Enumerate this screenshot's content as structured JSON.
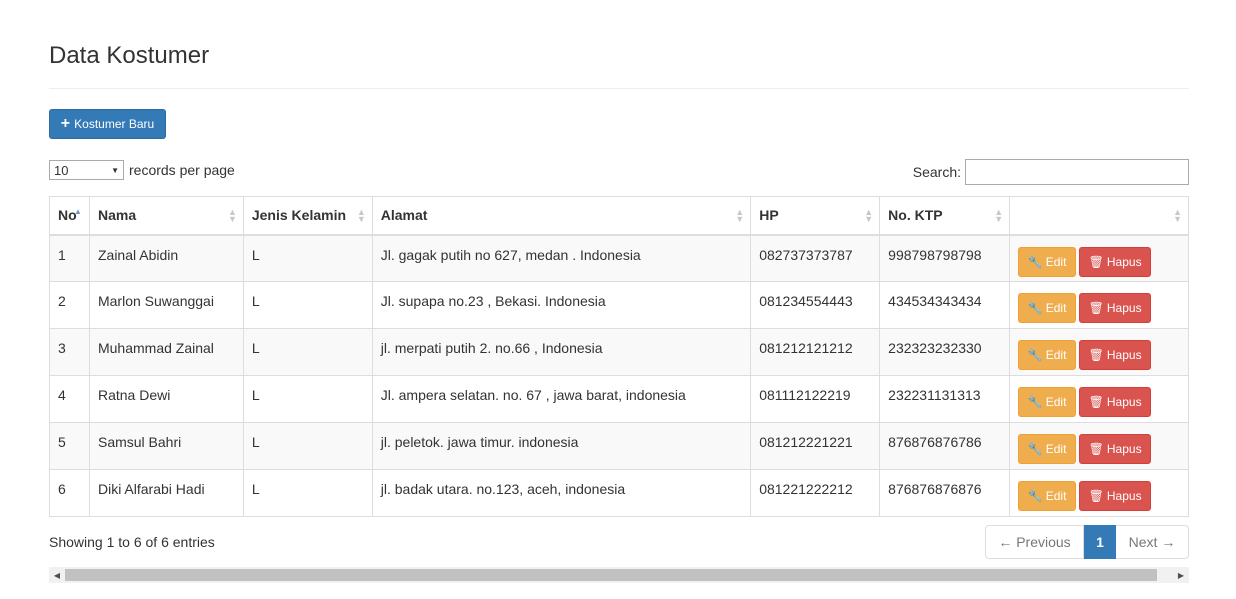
{
  "page": {
    "title": "Data Kostumer"
  },
  "toolbar": {
    "add_label": "Kostumer Baru",
    "add_icon": "plus-icon"
  },
  "length": {
    "value": "10",
    "label": "records per page"
  },
  "search": {
    "label": "Search:",
    "value": "",
    "placeholder": ""
  },
  "table": {
    "headers": [
      "No",
      "Nama",
      "Jenis Kelamin",
      "Alamat",
      "HP",
      "No. KTP",
      ""
    ],
    "rows": [
      [
        "1",
        "Zainal Abidin",
        "L",
        "Jl. gagak putih no 627, medan . Indonesia",
        "082737373787",
        "998798798798"
      ],
      [
        "2",
        "Marlon Suwanggai",
        "L",
        "Jl. supapa no.23 , Bekasi. Indonesia",
        "081234554443",
        "434534343434"
      ],
      [
        "3",
        "Muhammad Zainal",
        "L",
        "jl. merpati putih 2. no.66 , Indonesia",
        "081212121212",
        "232323232330"
      ],
      [
        "4",
        "Ratna Dewi",
        "L",
        "Jl. ampera selatan. no. 67 , jawa barat, indonesia",
        "081112122219",
        "232231131313"
      ],
      [
        "5",
        "Samsul Bahri",
        "L",
        "jl. peletok. jawa timur. indonesia",
        "081212221221",
        "876876876786"
      ],
      [
        "6",
        "Diki Alfarabi Hadi",
        "L",
        "jl. badak utara. no.123, aceh, indonesia",
        "081221222212",
        "876876876876"
      ]
    ],
    "edit_label": "Edit",
    "delete_label": "Hapus"
  },
  "footer": {
    "info": "Showing 1 to 6 of 6 entries",
    "prev": "← Previous",
    "page": "1",
    "next": "Next →"
  },
  "colors": {
    "primary": "#337ab7",
    "warning": "#f0ad4e",
    "danger": "#d9534f"
  }
}
